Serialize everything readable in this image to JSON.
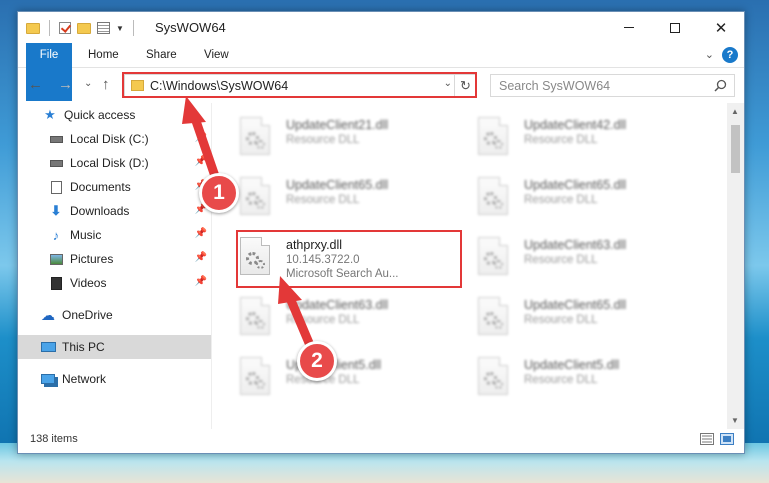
{
  "window": {
    "title": "SysWOW64",
    "minimize_glyph": "",
    "close_glyph": "✕"
  },
  "ribbon": {
    "tabs": [
      "File",
      "Home",
      "Share",
      "View"
    ],
    "help_glyph": "?"
  },
  "address": {
    "path": "C:\\Windows\\SysWOW64",
    "dropdown_glyph": "⌄",
    "refresh_glyph": "↻",
    "search_placeholder": "Search SysWOW64"
  },
  "nav": {
    "back_glyph": "←",
    "forward_glyph": "→",
    "recent_glyph": "⌄",
    "up_glyph": "↑"
  },
  "sidebar": {
    "items": [
      {
        "label": "Quick access",
        "icon": "star-icon"
      },
      {
        "label": "Local Disk (C:)",
        "icon": "drive-icon"
      },
      {
        "label": "Local Disk (D:)",
        "icon": "drive-icon"
      },
      {
        "label": "Documents",
        "icon": "documents-icon"
      },
      {
        "label": "Downloads",
        "icon": "download-icon"
      },
      {
        "label": "Music",
        "icon": "music-icon"
      },
      {
        "label": "Pictures",
        "icon": "pictures-icon"
      },
      {
        "label": "Videos",
        "icon": "videos-icon"
      },
      {
        "label": "OneDrive",
        "icon": "cloud-icon"
      },
      {
        "label": "This PC",
        "icon": "computer-icon"
      },
      {
        "label": "Network",
        "icon": "network-icon"
      }
    ]
  },
  "files": [
    {
      "name": "UpdateClient21.dll",
      "type": "Resource DLL"
    },
    {
      "name": "UpdateClient42.dll",
      "type": "Resource DLL"
    },
    {
      "name": "UpdateClient65.dll",
      "type": "Resource DLL"
    },
    {
      "name": "UpdateClient65.dll",
      "type": "Resource DLL"
    },
    {
      "name": "athprxy.dll",
      "version": "10.145.3722.0",
      "description": "Microsoft Search Au..."
    },
    {
      "name": "UpdateClient63.dll",
      "type": "Resource DLL"
    },
    {
      "name": "UpdateClient63.dll",
      "type": "Resource DLL"
    },
    {
      "name": "UpdateClient65.dll",
      "type": "Resource DLL"
    },
    {
      "name": "UpdateClient5.dll",
      "type": "Resource DLL"
    },
    {
      "name": "UpdateClient5.dll",
      "type": "Resource DLL"
    }
  ],
  "status": {
    "item_count": "138 items"
  },
  "annotations": {
    "step1": "1",
    "step2": "2",
    "color": "#e33838"
  }
}
